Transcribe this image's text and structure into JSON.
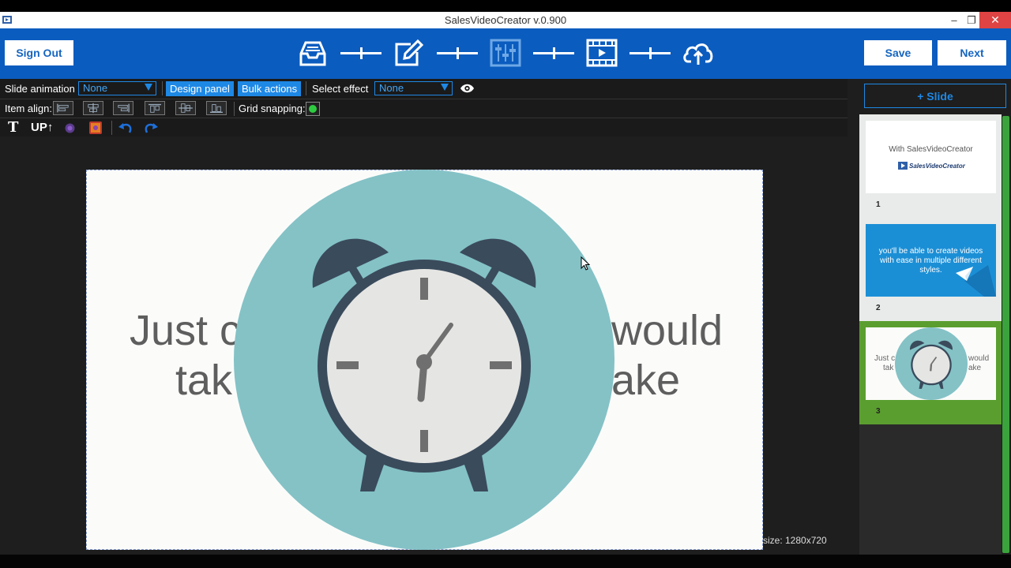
{
  "window": {
    "title": "SalesVideoCreator v.0.900",
    "minimize": "–",
    "maximize": "❐",
    "close": "✕"
  },
  "toolbar": {
    "sign_out_label": "Sign Out",
    "save_label": "Save",
    "next_label": "Next",
    "steps": [
      {
        "icon": "inbox-tray-icon"
      },
      {
        "icon": "edit-pencil-icon"
      },
      {
        "icon": "sliders-panel-icon",
        "state": "disabled"
      },
      {
        "icon": "video-film-icon"
      },
      {
        "icon": "cloud-upload-icon"
      }
    ]
  },
  "design_bar": {
    "slide_animation_label": "Slide animation",
    "slide_animation_value": "None",
    "design_panel_label": "Design panel",
    "bulk_actions_label": "Bulk actions",
    "select_effect_label": "Select effect",
    "select_effect_value": "None",
    "item_align_label": "Item align:",
    "grid_snapping_label": "Grid snapping:",
    "grid_snapping_on": true,
    "text_tool_label": "T",
    "upload_label": "UP↑"
  },
  "canvas": {
    "line1_left": "Just c",
    "line1_right": "would",
    "line2_left": "tak",
    "line2_right": "ake",
    "size_label": "size:  1280x720"
  },
  "slides_panel": {
    "add_slide_label": "+ Slide",
    "slides": [
      {
        "number": "1",
        "text": "With SalesVideoCreator",
        "logo_text": "SalesVideoCreator"
      },
      {
        "number": "2",
        "text": "you'll be able to create videos with ease in multiple different styles."
      },
      {
        "number": "3",
        "text_left_1": "Just c",
        "text_left_2": "tak",
        "text_right_1": "would",
        "text_right_2": "ake"
      }
    ]
  },
  "colors": {
    "toolbar_blue": "#0b5cbf",
    "accent_blue": "#1e88e5",
    "active_slide_green": "#5a9e2f",
    "clock_bg": "#84c2c6",
    "clock_dark": "#3a4b5c"
  }
}
